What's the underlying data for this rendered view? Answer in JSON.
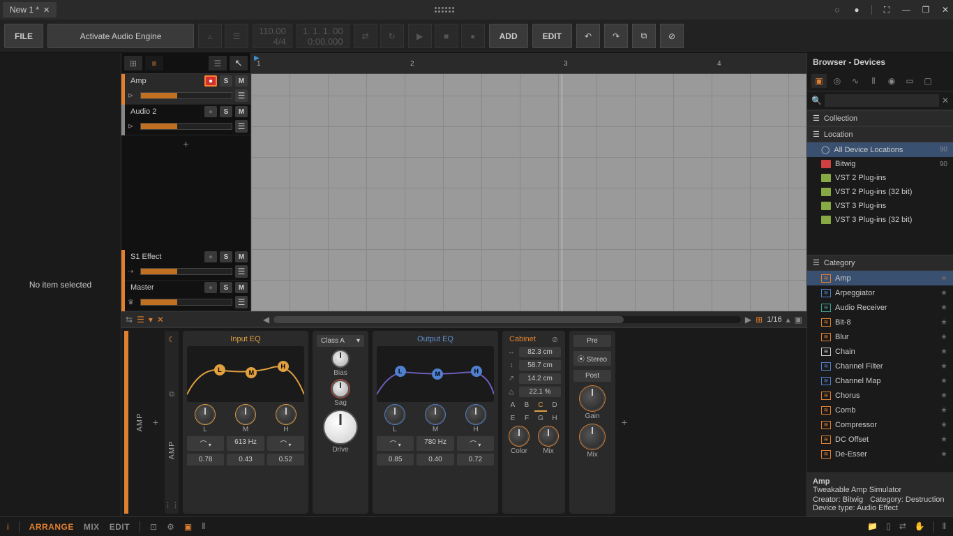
{
  "titlebar": {
    "tab_name": "New 1 *"
  },
  "toolbar": {
    "file": "FILE",
    "activate": "Activate Audio Engine",
    "tempo": "110.00",
    "sig": "4/4",
    "position": "1. 1. 1. 00",
    "time": "0:00.000",
    "add": "ADD",
    "edit": "EDIT"
  },
  "left_pane": {
    "empty": "No item selected"
  },
  "tracks": [
    {
      "name": "Amp",
      "color": "#e08030",
      "rec": true
    },
    {
      "name": "Audio 2",
      "color": "#888",
      "rec": false
    }
  ],
  "fx_tracks": [
    {
      "name": "S1 Effect",
      "color": "#e08030"
    },
    {
      "name": "Master",
      "color": "#e08030"
    }
  ],
  "ruler": {
    "m1": "1",
    "m2": "2",
    "m3": "3",
    "m4": "4"
  },
  "scroll": {
    "zoom": "1/16"
  },
  "device": {
    "label": "AMP",
    "input_eq": {
      "title": "Input EQ",
      "bands": [
        "L",
        "M",
        "H"
      ],
      "freq": "613 Hz",
      "vals": [
        "0.78",
        "0.43",
        "0.52"
      ]
    },
    "amp": {
      "class": "Class A",
      "bias": "Bias",
      "sag": "Sag",
      "drive": "Drive"
    },
    "output_eq": {
      "title": "Output EQ",
      "bands": [
        "L",
        "M",
        "H"
      ],
      "freq": "780 Hz",
      "vals": [
        "0.85",
        "0.40",
        "0.72"
      ]
    },
    "cabinet": {
      "title": "Cabinet",
      "p0": "82.3 cm",
      "p1": "58.7 cm",
      "p2": "14.2 cm",
      "p3": "22.1 %",
      "grid1": [
        "A",
        "B",
        "C",
        "D"
      ],
      "grid2": [
        "E",
        "F",
        "G",
        "H"
      ],
      "color": "Color",
      "mix": "Mix"
    },
    "post": {
      "pre": "Pre",
      "stereo": "Stereo",
      "post": "Post",
      "gain": "Gain",
      "mix": "Mix"
    }
  },
  "browser": {
    "title": "Browser - Devices",
    "search_ph": "",
    "collection": "Collection",
    "location": "Location",
    "locations": [
      {
        "label": "All Device Locations",
        "count": "90"
      },
      {
        "label": "Bitwig",
        "count": "90"
      },
      {
        "label": "VST 2 Plug-ins"
      },
      {
        "label": "VST 2 Plug-ins (32 bit)"
      },
      {
        "label": "VST 3 Plug-ins"
      },
      {
        "label": "VST 3 Plug-ins (32 bit)"
      }
    ],
    "category": "Category",
    "devices": [
      {
        "name": "Amp",
        "sel": true,
        "cls": "orange"
      },
      {
        "name": "Arpeggiator",
        "cls": "blue"
      },
      {
        "name": "Audio Receiver",
        "cls": "teal"
      },
      {
        "name": "Bit-8",
        "cls": "orange"
      },
      {
        "name": "Blur",
        "cls": "orange"
      },
      {
        "name": "Chain",
        "cls": "white"
      },
      {
        "name": "Channel Filter",
        "cls": "blue"
      },
      {
        "name": "Channel Map",
        "cls": "blue"
      },
      {
        "name": "Chorus",
        "cls": "orange"
      },
      {
        "name": "Comb",
        "cls": "orange"
      },
      {
        "name": "Compressor",
        "cls": "orange"
      },
      {
        "name": "DC Offset",
        "cls": "orange"
      },
      {
        "name": "De-Esser",
        "cls": "orange"
      }
    ],
    "info": {
      "name": "Amp",
      "desc": "Tweakable Amp Simulator",
      "creator": "Creator: Bitwig",
      "cat": "Category: Destruction",
      "type": "Device type: Audio Effect"
    }
  },
  "footer": {
    "arrange": "ARRANGE",
    "mix": "MIX",
    "edit": "EDIT"
  }
}
